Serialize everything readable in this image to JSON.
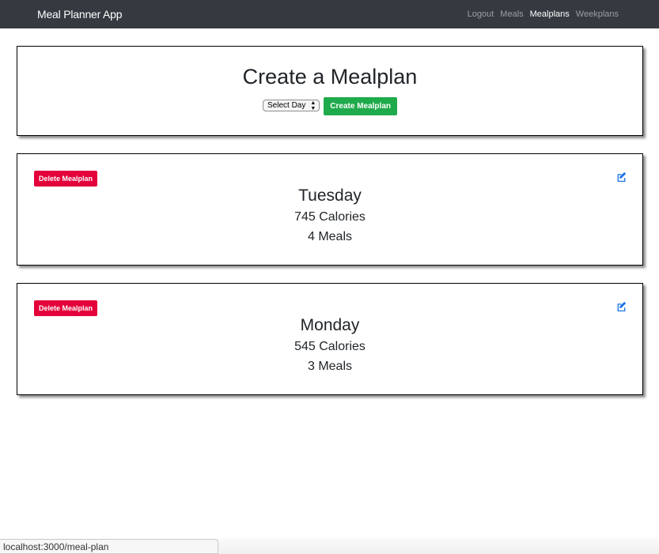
{
  "navbar": {
    "brand": "Meal Planner App",
    "links": [
      {
        "label": "Logout",
        "active": false
      },
      {
        "label": "Meals",
        "active": false
      },
      {
        "label": "Mealplans",
        "active": true
      },
      {
        "label": "Weekplans",
        "active": false
      }
    ]
  },
  "create": {
    "title": "Create a Mealplan",
    "select_value": "Select Day",
    "button_label": "Create Mealplan"
  },
  "mealplans": [
    {
      "delete_label": "Delete Mealplan",
      "day": "Tuesday",
      "calories": "745 Calories",
      "meals": "4 Meals",
      "edit_icon": "edit-icon"
    },
    {
      "delete_label": "Delete Mealplan",
      "day": "Monday",
      "calories": "545 Calories",
      "meals": "3 Meals",
      "edit_icon": "edit-icon"
    }
  ],
  "status_bar": {
    "url": "localhost:3000/meal-plan"
  },
  "colors": {
    "navbar": "#343a40",
    "create_button": "#1faa4b",
    "delete_button": "#e4003a",
    "edit_icon": "#1a73e8"
  }
}
